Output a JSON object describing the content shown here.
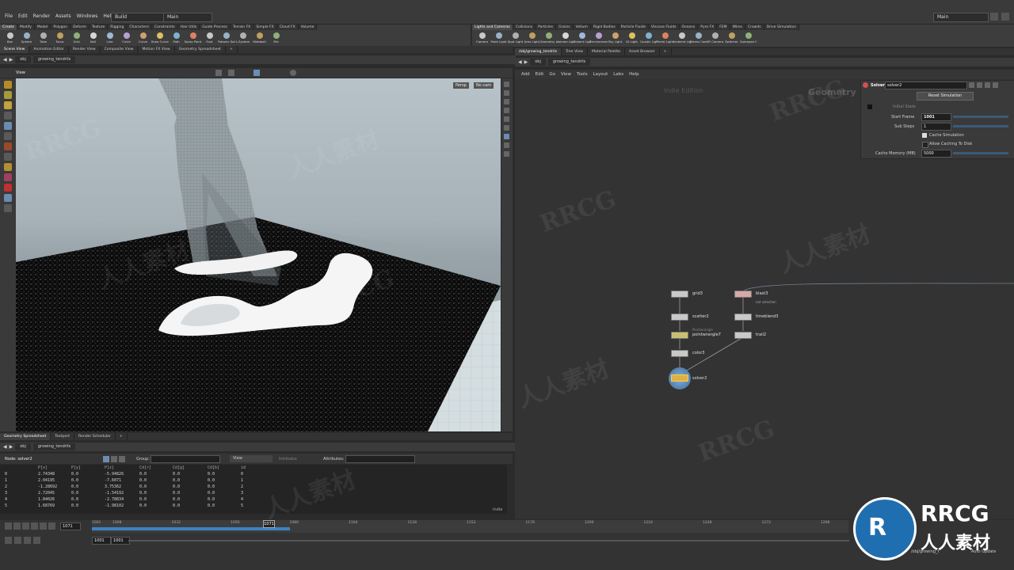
{
  "menubar": {
    "items": [
      "File",
      "Edit",
      "Render",
      "Assets",
      "Windows",
      "Help"
    ],
    "desktop": "Build",
    "context": "Main",
    "desktop_right": "Main"
  },
  "shelf_left": {
    "tabs": [
      "Create",
      "Modify",
      "Model",
      "Polygon",
      "Deform",
      "Texture",
      "Rigging",
      "Characters",
      "Constraints",
      "Hair Utils",
      "Guide Process",
      "Terrain FX",
      "Simple FX",
      "Cloud FX",
      "Volume"
    ],
    "tools": [
      "Box",
      "Sphere",
      "Tube",
      "Torus",
      "Grid",
      "Null",
      "Line",
      "Circle",
      "Curve",
      "Draw Curve",
      "Path",
      "Spray Paint",
      "Font",
      "Platonic Solids",
      "L-System",
      "Metaball",
      "File"
    ]
  },
  "shelf_right": {
    "tabs": [
      "Lights and Cameras",
      "Collisions",
      "Particles",
      "Grains",
      "Vellum",
      "Rigid Bodies",
      "Particle Fluids",
      "Viscous Fluids",
      "Oceans",
      "Pyro FX",
      "FEM",
      "Wires",
      "Crowds",
      "Drive Simulation"
    ],
    "tools": [
      "Camera",
      "Point Light",
      "Spot Light",
      "Area Light",
      "Geometry Light",
      "Volume Light",
      "Distant Light",
      "Environment Light",
      "Sky Light",
      "GI Light",
      "Caustic Light",
      "Portal Light",
      "Ambient Light",
      "Stereo Camera",
      "VR Camera",
      "Switcher",
      "Gamepad Camera"
    ]
  },
  "left_pane": {
    "tabs": [
      "Scene View",
      "Animation Editor",
      "Render View",
      "Composite View",
      "Motion FX View",
      "Geometry Spreadsheet"
    ],
    "path": [
      "obj",
      "growing_tendrils"
    ],
    "viewport_label": "View",
    "persp": "Persp",
    "cam": "No cam"
  },
  "right_pane": {
    "tabs": [
      "/obj/growing_tendrils",
      "Tree View",
      "Material Palette",
      "Asset Browser"
    ],
    "path": [
      "obj",
      "growing_tendrils"
    ],
    "menu": [
      "Add",
      "Edit",
      "Go",
      "View",
      "Tools",
      "Layout",
      "Labs",
      "Help"
    ],
    "network_type": "Geometry",
    "watermark_label": "Indie Edition"
  },
  "params": {
    "node_type": "Solver",
    "node_name": "solver2",
    "reset_button": "Reset Simulation",
    "initial_state_label": "Initial State",
    "start_frame_label": "Start Frame",
    "start_frame": "1001",
    "sub_steps_label": "Sub Steps",
    "sub_steps": "1",
    "cache_sim_label": "Cache Simulation",
    "allow_disk_label": "Allow Caching To Disk",
    "cache_mem_label": "Cache Memory (MB)",
    "cache_mem": "5000"
  },
  "nodes": {
    "grid": "grid3",
    "scatter": "scatter2",
    "pointwrangle": "pointwrangle7",
    "pointwrangle_comment": "Pointwrangle",
    "color": "color3",
    "solver": "solver2",
    "blast": "blast3",
    "blast_comment": "not selection",
    "timeblend": "timeblend3",
    "trail": "trail2"
  },
  "bottom_pane": {
    "tabs": [
      "Geometry Spreadsheet",
      "Textport",
      "Render Scheduler"
    ],
    "path": [
      "obj",
      "growing_tendrils"
    ],
    "node_label": "Node: solver2",
    "group_label": "Group:",
    "view_label": "View",
    "intrinsics_label": "Intrinsics",
    "attributes_label": "Attributes:",
    "columns": [
      "",
      "P[x]",
      "P[y]",
      "P[z]",
      "Cd[r]",
      "Cd[g]",
      "Cd[b]",
      "id"
    ],
    "rows": [
      [
        "0",
        "2.74348",
        "0.0",
        "-5.94826",
        "0.0",
        "0.0",
        "0.0",
        "0"
      ],
      [
        "1",
        "2.04195",
        "0.0",
        "-7.6071",
        "0.0",
        "0.0",
        "0.0",
        "1"
      ],
      [
        "2",
        "-1.28692",
        "0.0",
        "3.75362",
        "0.0",
        "0.0",
        "0.0",
        "2"
      ],
      [
        "3",
        "2.72045",
        "0.0",
        "-1.54192",
        "0.0",
        "0.0",
        "0.0",
        "3"
      ],
      [
        "4",
        "1.84026",
        "0.0",
        "-2.78834",
        "0.0",
        "0.0",
        "0.0",
        "4"
      ],
      [
        "5",
        "1.68769",
        "0.0",
        "-1.98102",
        "0.0",
        "0.0",
        "0.0",
        "5"
      ]
    ],
    "indie": "Indie"
  },
  "timeline": {
    "frame": "1071",
    "ticks": [
      "1001",
      "1008",
      "1032",
      "1056",
      "1080",
      "1104",
      "1128",
      "1152",
      "1176",
      "1200",
      "1224",
      "1248",
      "1272",
      "1296"
    ],
    "marker": "1071",
    "range_start": "1001",
    "range_end": "1001",
    "status_path": "/obj/growing_t",
    "auto_update": "Auto Update"
  },
  "watermarks": [
    "RRCG",
    "人人素材"
  ],
  "logo": {
    "line1": "RRCG",
    "line2": "人人素材"
  }
}
